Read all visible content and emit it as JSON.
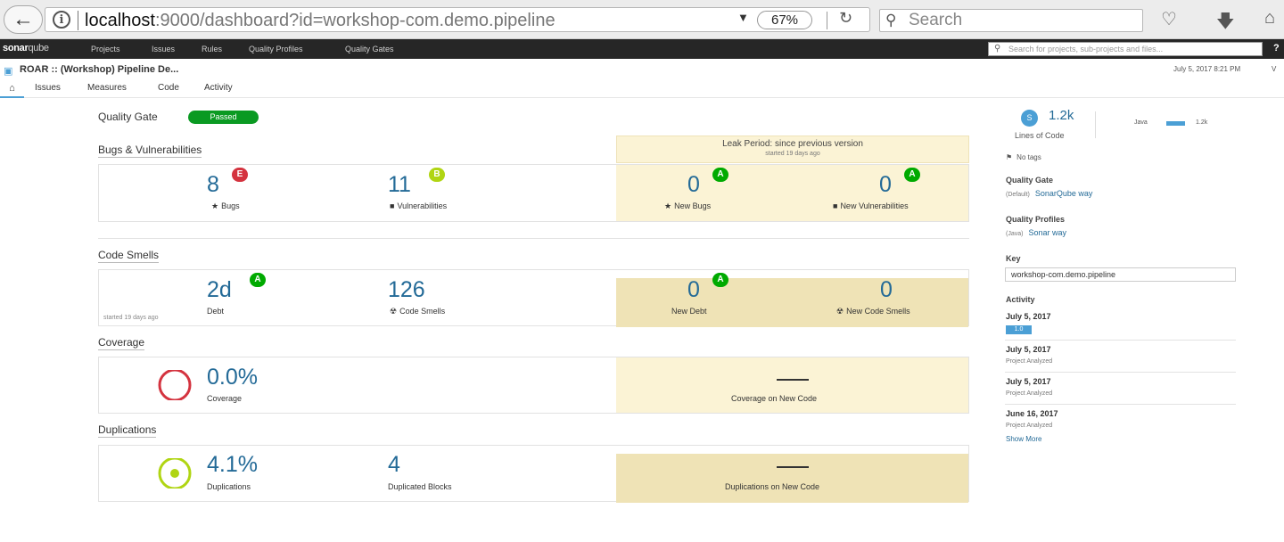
{
  "browser": {
    "url_host": "localhost",
    "url_rest": ":9000/dashboard?id=workshop-com.demo.pipeline",
    "zoom": "67%",
    "search_placeholder": "Search"
  },
  "nav": {
    "logo_bold": "sonar",
    "logo_rest": "qube",
    "items": [
      "Projects",
      "Issues",
      "Rules",
      "Quality Profiles",
      "Quality Gates"
    ],
    "search_placeholder": "Search for projects, sub-projects and files..."
  },
  "project": {
    "title": "ROAR :: (Workshop) Pipeline De...",
    "date": "July 5, 2017 8:21 PM",
    "version_fragment": "V",
    "tabs": [
      "Issues",
      "Measures",
      "Code",
      "Activity"
    ]
  },
  "quality_gate": {
    "label": "Quality Gate",
    "status": "Passed"
  },
  "leak": {
    "title": "Leak Period: since previous version",
    "started": "started 19 days ago"
  },
  "bugs": {
    "title": "Bugs & Vulnerabilities",
    "bugs": {
      "value": "8",
      "grade": "E",
      "label": "Bugs"
    },
    "vulnerabilities": {
      "value": "11",
      "grade": "B",
      "label": "Vulnerabilities"
    },
    "new_bugs": {
      "value": "0",
      "grade": "A",
      "label": "New Bugs"
    },
    "new_vulnerabilities": {
      "value": "0",
      "grade": "A",
      "label": "New Vulnerabilities"
    }
  },
  "smells": {
    "title": "Code Smells",
    "debt": {
      "value": "2d",
      "grade": "A",
      "label": "Debt"
    },
    "code_smells": {
      "value": "126",
      "label": "Code Smells"
    },
    "new_debt": {
      "value": "0",
      "grade": "A",
      "label": "New Debt"
    },
    "new_code_smells": {
      "value": "0",
      "label": "New Code Smells"
    },
    "started": "started 19 days ago"
  },
  "coverage": {
    "title": "Coverage",
    "value": "0.0%",
    "label": "Coverage",
    "new_label": "Coverage on New Code"
  },
  "duplications": {
    "title": "Duplications",
    "value": "4.1%",
    "label": "Duplications",
    "blocks_value": "4",
    "blocks_label": "Duplicated Blocks",
    "new_label": "Duplications on New Code"
  },
  "sidebar": {
    "loc_badge": "S",
    "loc_value": "1.2k",
    "loc_label": "Lines of Code",
    "lang_name": "Java",
    "lang_value": "1.2k",
    "tags": "No tags",
    "qg_title": "Quality Gate",
    "qg_meta": "(Default)",
    "qg_link": "SonarQube way",
    "qp_title": "Quality Profiles",
    "qp_meta": "(Java)",
    "qp_link": "Sonar way",
    "key_title": "Key",
    "key_value": "workshop-com.demo.pipeline",
    "activity_title": "Activity",
    "activity": [
      {
        "date": "July 5, 2017",
        "sub": "1.0"
      },
      {
        "date": "July 5, 2017",
        "sub": "Project Analyzed"
      },
      {
        "date": "July 5, 2017",
        "sub": "Project Analyzed"
      },
      {
        "date": "June 16, 2017",
        "sub": "Project Analyzed"
      }
    ],
    "show_more": "Show More"
  },
  "colors": {
    "accent": "#236a97",
    "passed": "#0a9a22",
    "leak": "#fbf3d5",
    "grade_a": "#00aa00",
    "grade_b": "#b0d513",
    "grade_e": "#d4333f"
  }
}
